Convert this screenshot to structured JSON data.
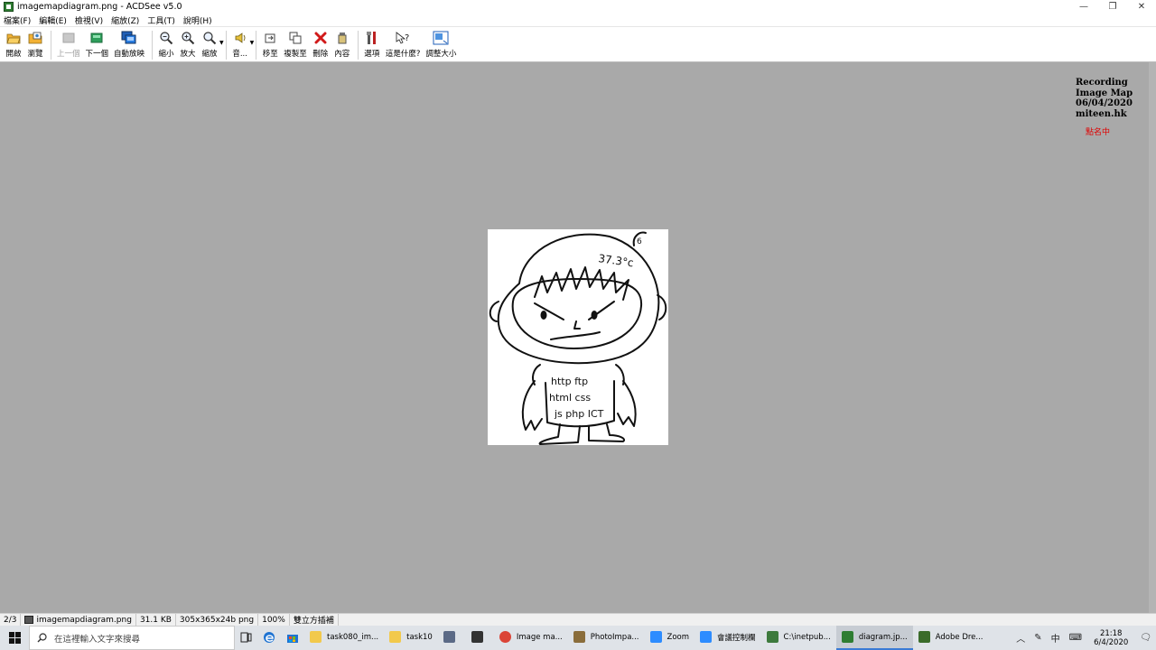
{
  "window": {
    "title": "imagemapdiagram.png - ACDSee v5.0",
    "minimize": "—",
    "restore": "❐",
    "close": "✕"
  },
  "menu": [
    "檔案(F)",
    "編輯(E)",
    "檢視(V)",
    "縮放(Z)",
    "工具(T)",
    "說明(H)"
  ],
  "toolbar": {
    "open": "開啟",
    "browse": "瀏覽",
    "prev": "上一個",
    "next": "下一個",
    "slideshow": "自動放映",
    "zoom_out": "縮小",
    "zoom_in": "放大",
    "zoom": "縮放",
    "sound": "音...",
    "move_to": "移至",
    "copy_to": "複製至",
    "delete": "刪除",
    "properties": "內容",
    "options": "選項",
    "whats_this": "這是什麼?",
    "resize": "調整大小"
  },
  "image": {
    "temp": "37.3°c",
    "shirt_line1": "http  ftp",
    "shirt_line2": "html  css",
    "shirt_line3": "js  php  ICT",
    "mark": "6"
  },
  "overlay": {
    "line1": "Recording",
    "line2": "Image Map",
    "line3": "06/04/2020",
    "line4": "miteen.hk",
    "red": "點名中"
  },
  "status": {
    "index": "2/3",
    "filename": "imagemapdiagram.png",
    "size": "31.1 KB",
    "dims": "305x365x24b png",
    "zoom": "100%",
    "mode": "雙立方插補"
  },
  "taskbar": {
    "search_placeholder": "在這裡輸入文字來搜尋",
    "apps": [
      {
        "label": "task080_im...",
        "color": "#f2c94c"
      },
      {
        "label": "task10",
        "color": "#f2c94c"
      },
      {
        "label": "",
        "color": "#5b6a86"
      },
      {
        "label": "",
        "color": "#333333"
      },
      {
        "label": "Image ma...",
        "color": "#db4437"
      },
      {
        "label": "PhotoImpa...",
        "color": "#8a6d3b"
      },
      {
        "label": "Zoom",
        "color": "#2d8cff"
      },
      {
        "label": "會議控制欄",
        "color": "#2d8cff"
      },
      {
        "label": "C:\\inetpub...",
        "color": "#3d7a3d"
      },
      {
        "label": "diagram.jp...",
        "color": "#2e7d32"
      },
      {
        "label": "Adobe Dre...",
        "color": "#3a6b2a"
      }
    ],
    "ime": "中",
    "time": "21:18",
    "date": "6/4/2020"
  }
}
